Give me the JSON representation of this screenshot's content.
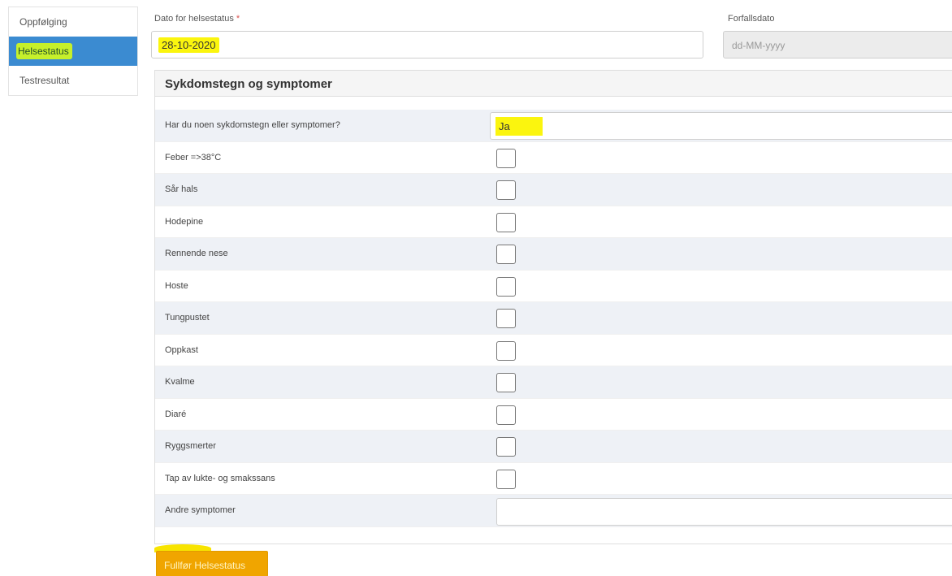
{
  "sidebar": {
    "items": [
      {
        "label": "Oppfølging",
        "active": false
      },
      {
        "label": "Helsestatus",
        "active": true
      },
      {
        "label": "Testresultat",
        "active": false
      }
    ]
  },
  "form": {
    "date_label": "Dato for helsestatus",
    "required_mark": "*",
    "date_value": "28-10-2020",
    "due_label": "Forfallsdato",
    "due_placeholder": "dd-MM-yyyy"
  },
  "panel": {
    "title": "Sykdomstegn og symptomer",
    "question": {
      "label": "Har du noen sykdomstegn eller symptomer?",
      "value": "Ja"
    },
    "symptoms": [
      {
        "label": "Feber =>38°C",
        "checked": false
      },
      {
        "label": "Sår hals",
        "checked": false
      },
      {
        "label": "Hodepine",
        "checked": false
      },
      {
        "label": "Rennende nese",
        "checked": false
      },
      {
        "label": "Hoste",
        "checked": false
      },
      {
        "label": "Tungpustet",
        "checked": false
      },
      {
        "label": "Oppkast",
        "checked": false
      },
      {
        "label": "Kvalme",
        "checked": false
      },
      {
        "label": "Diaré",
        "checked": false
      },
      {
        "label": "Ryggsmerter",
        "checked": false
      },
      {
        "label": "Tap av lukte- og smakssans",
        "checked": false
      }
    ],
    "other_label": "Andre symptomer",
    "other_value": ""
  },
  "actions": {
    "submit_label": "Fullfør Helsestatus"
  },
  "colors": {
    "accent": "#3b8bd1",
    "highlight": "#fbf50e",
    "submit": "#f0a500"
  }
}
